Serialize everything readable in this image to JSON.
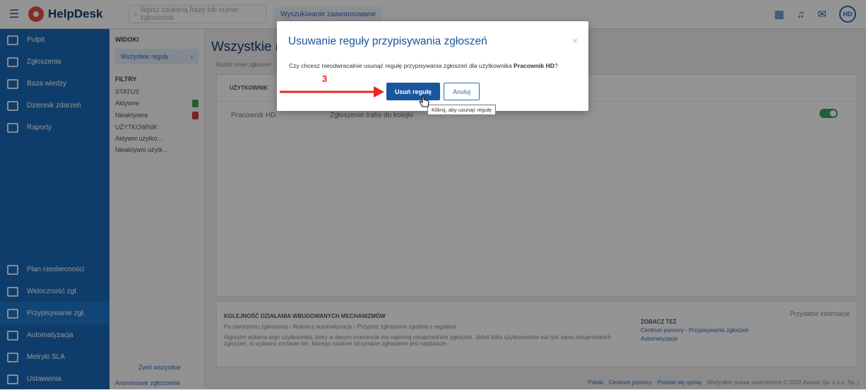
{
  "app": {
    "name": "HelpDesk",
    "search_placeholder": "Wpisz szukaną frazę lub numer zgłoszenia",
    "advanced_search": "Wyszukiwanie zaawansowane",
    "avatar_initials": "HD"
  },
  "sidebar": {
    "items_top": [
      {
        "label": "Pulpit",
        "icon": "dashboard-icon"
      },
      {
        "label": "Zgłoszenia",
        "icon": "tickets-icon"
      },
      {
        "label": "Baza wiedzy",
        "icon": "knowledge-base-icon"
      },
      {
        "label": "Dziennik zdarzeń",
        "icon": "event-log-icon"
      },
      {
        "label": "Raporty",
        "icon": "reports-icon"
      }
    ],
    "items_bottom": [
      {
        "label": "Plan nieobecności",
        "icon": "absence-icon"
      },
      {
        "label": "Widoczność zgł.",
        "icon": "visibility-icon"
      },
      {
        "label": "Przypisywanie zgł.",
        "icon": "assignment-icon",
        "active": true
      },
      {
        "label": "Automatyzacja",
        "icon": "automation-icon"
      },
      {
        "label": "Metryki SLA",
        "icon": "sla-icon"
      },
      {
        "label": "Ustawienia",
        "icon": "settings-icon"
      }
    ]
  },
  "views": {
    "title": "WIDOKI",
    "all_rules": "Wszystkie reguły",
    "filters_title": "FILTRY",
    "status_title": "STATUS",
    "status_active": "Aktywne",
    "status_inactive": "Nieaktywne",
    "users_title": "UŻYTKOWNIK",
    "active_users": "Aktywni użytko...",
    "inactive_users": "Nieaktywni użytk...",
    "collapse_all": "Zwiń wszystkie",
    "anonymous": "Anonimowe zgłoszenie"
  },
  "main": {
    "title": "Wszystkie r",
    "subtitle": "Każde nowe zgłoszen",
    "col_user": "UŻYTKOWNIK",
    "row_user": "Pracownik HD",
    "row_rule": "Zgłoszenie trafia do kolejki",
    "info_title": "KOLEJNOŚĆ DZIAŁANIA WBUDOWANYCH MECHANIZMÓW",
    "info_flow": "Po stworzeniu zgłoszenia  ›  Wykonuj automatyzacje  ›  Przypisz zgłoszenie zgodnie z regułami",
    "info_text": "Algorytm wybiera tego użytkownika, który w danym momencie ma najmniej nieuprzednich zgłoszeń. Jeżeli kilku użytkowników ma tyle samo nieuprzednich zgłoszeń, to wybrany zostanie ten, którego ostatnie otrzymane zgłoszenie jest najstarsze.",
    "more_info": "Przydatne informacje",
    "see_also": "ZOBACZ TEŻ",
    "link1": "Centrum pomocy - Przypisywanie zgłoszeń",
    "link2": "Automatyzacje"
  },
  "footer": {
    "lang": "Polski",
    "help": "Centrum pomocy",
    "share": "Podziel się opinią",
    "rights": "Wszystkie prawa zastrzeżone © 2022 Avanor Sp. z o.o. Sp. j."
  },
  "modal": {
    "title": "Usuwanie reguły przypisywania zgłoszeń",
    "text_before": "Czy chcesz nieodwracalnie usunąć regułę przypisywania zgłoszeń dla użytkownika ",
    "text_user": "Pracownik HD",
    "text_after": "?",
    "confirm_label": "Usuń regułę",
    "cancel_label": "Anuluj",
    "close_glyph": "×",
    "tooltip": "Kliknij, aby usunąć regułę"
  },
  "annotation": {
    "step_number": "3"
  }
}
